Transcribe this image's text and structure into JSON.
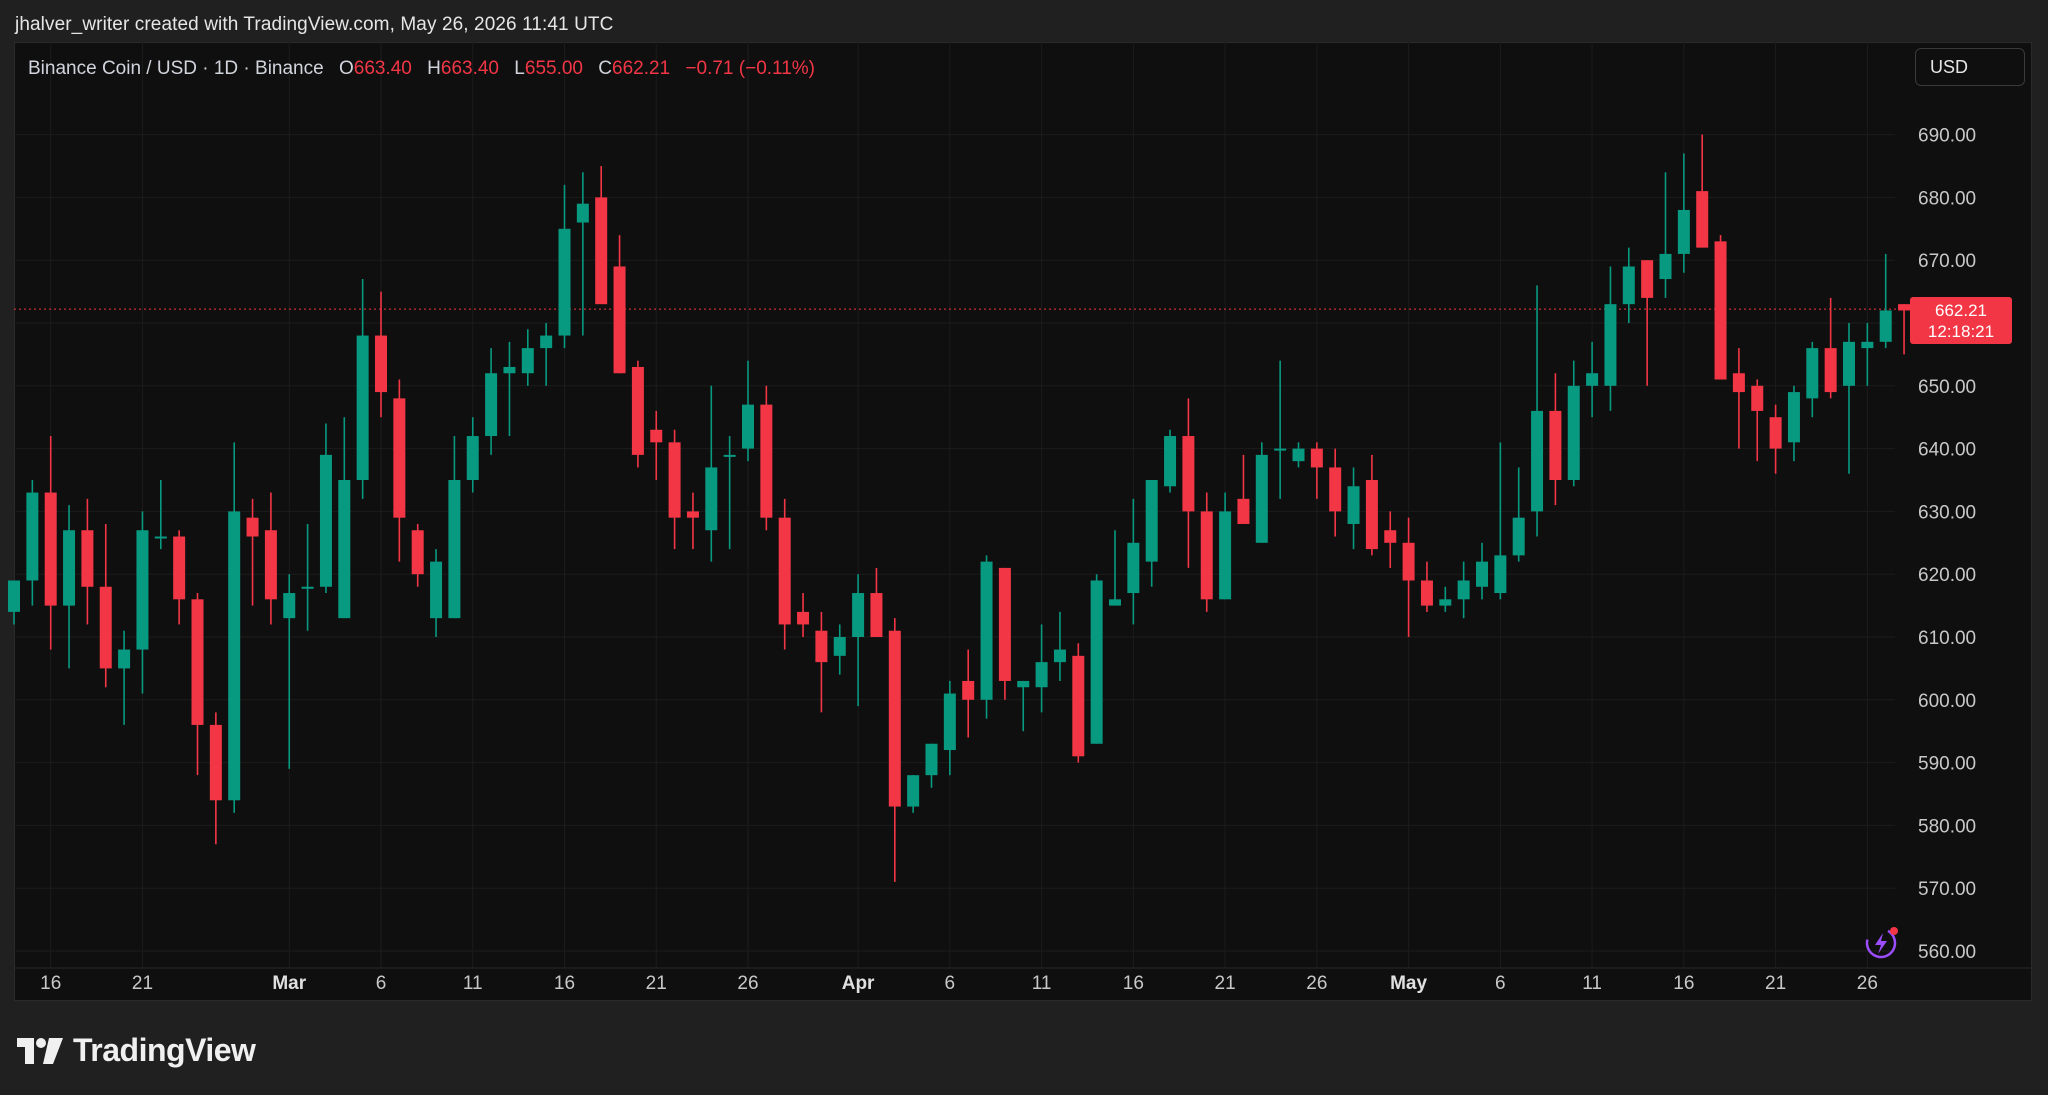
{
  "header": {
    "caption": "jhalver_writer created with TradingView.com, May 26, 2026 11:41 UTC"
  },
  "legend": {
    "symbol": "Binance Coin / USD · 1D · Binance",
    "o_label": "O",
    "o_value": "663.40",
    "h_label": "H",
    "h_value": "663.40",
    "l_label": "L",
    "l_value": "655.00",
    "c_label": "C",
    "c_value": "662.21",
    "change": "−0.71 (−0.11%)"
  },
  "currency_button": {
    "label": "USD"
  },
  "last_price": {
    "price": "662.21",
    "countdown": "12:18:21"
  },
  "brand": {
    "name": "TradingView"
  },
  "icons": {
    "logo": "tradingview-logo-icon",
    "alert": "lightning-alert-icon"
  },
  "colors": {
    "up": "#089981",
    "down": "#f23645",
    "background": "#0f0f0f",
    "grid": "#1c1c1c",
    "alert_icon": "#9c4dff"
  },
  "chart_data": {
    "type": "candlestick",
    "title": "Binance Coin / USD · 1D · Binance",
    "ylim": [
      558,
      695
    ],
    "y_ticks": [
      560,
      570,
      580,
      590,
      600,
      610,
      620,
      630,
      640,
      650,
      660,
      670,
      680,
      690
    ],
    "y_tick_labels": [
      "560.00",
      "570.00",
      "580.00",
      "590.00",
      "600.00",
      "610.00",
      "620.00",
      "630.00",
      "640.00",
      "650.00",
      "660.00",
      "670.00",
      "680.00",
      "690.00"
    ],
    "x_ticks": [
      {
        "label": "16",
        "index": 2,
        "bold": false
      },
      {
        "label": "21",
        "index": 7,
        "bold": false
      },
      {
        "label": "Mar",
        "index": 15,
        "bold": true
      },
      {
        "label": "6",
        "index": 20,
        "bold": false
      },
      {
        "label": "11",
        "index": 25,
        "bold": false
      },
      {
        "label": "16",
        "index": 30,
        "bold": false
      },
      {
        "label": "21",
        "index": 35,
        "bold": false
      },
      {
        "label": "26",
        "index": 40,
        "bold": false
      },
      {
        "label": "Apr",
        "index": 46,
        "bold": true
      },
      {
        "label": "6",
        "index": 51,
        "bold": false
      },
      {
        "label": "11",
        "index": 56,
        "bold": false
      },
      {
        "label": "16",
        "index": 61,
        "bold": false
      },
      {
        "label": "21",
        "index": 66,
        "bold": false
      },
      {
        "label": "26",
        "index": 71,
        "bold": false
      },
      {
        "label": "May",
        "index": 76,
        "bold": true
      },
      {
        "label": "6",
        "index": 81,
        "bold": false
      },
      {
        "label": "11",
        "index": 86,
        "bold": false
      },
      {
        "label": "16",
        "index": 91,
        "bold": false
      },
      {
        "label": "21",
        "index": 96,
        "bold": false
      },
      {
        "label": "26",
        "index": 101,
        "bold": false
      }
    ],
    "last_price": 662.21,
    "candles": [
      [
        614,
        619,
        612,
        619
      ],
      [
        619,
        635,
        615,
        633
      ],
      [
        633,
        642,
        608,
        615
      ],
      [
        615,
        631,
        605,
        627
      ],
      [
        627,
        632,
        612,
        618
      ],
      [
        618,
        628,
        602,
        605
      ],
      [
        605,
        611,
        596,
        608
      ],
      [
        608,
        630,
        601,
        627
      ],
      [
        626,
        635,
        624,
        626
      ],
      [
        626,
        627,
        612,
        616
      ],
      [
        616,
        617,
        588,
        596
      ],
      [
        596,
        598,
        577,
        584
      ],
      [
        584,
        641,
        582,
        630
      ],
      [
        629,
        632,
        615,
        626
      ],
      [
        627,
        633,
        612,
        616
      ],
      [
        613,
        620,
        589,
        617
      ],
      [
        618,
        628,
        611,
        618
      ],
      [
        618,
        644,
        617,
        639
      ],
      [
        613,
        645,
        613,
        635
      ],
      [
        635,
        667,
        632,
        658
      ],
      [
        658,
        665,
        645,
        649
      ],
      [
        648,
        651,
        622,
        629
      ],
      [
        627,
        628,
        618,
        620
      ],
      [
        613,
        624,
        610,
        622
      ],
      [
        613,
        642,
        613,
        635
      ],
      [
        635,
        645,
        633,
        642
      ],
      [
        642,
        656,
        639,
        652
      ],
      [
        652,
        657,
        642,
        653
      ],
      [
        652,
        659,
        650,
        656
      ],
      [
        656,
        660,
        650,
        658
      ],
      [
        658,
        682,
        656,
        675
      ],
      [
        676,
        684,
        658,
        679
      ],
      [
        680,
        685,
        665,
        663
      ],
      [
        669,
        674,
        652,
        652
      ],
      [
        653,
        654,
        637,
        639
      ],
      [
        643,
        646,
        635,
        641
      ],
      [
        641,
        643,
        624,
        629
      ],
      [
        630,
        633,
        624,
        629
      ],
      [
        627,
        650,
        622,
        637
      ],
      [
        639,
        642,
        624,
        639
      ],
      [
        640,
        654,
        638,
        647
      ],
      [
        647,
        650,
        627,
        629
      ],
      [
        629,
        632,
        608,
        612
      ],
      [
        614,
        617,
        610,
        612
      ],
      [
        611,
        614,
        598,
        606
      ],
      [
        607,
        612,
        604,
        610
      ],
      [
        610,
        620,
        599,
        617
      ],
      [
        617,
        621,
        610,
        610
      ],
      [
        611,
        613,
        571,
        583
      ],
      [
        583,
        588,
        582,
        588
      ],
      [
        588,
        593,
        586,
        593
      ],
      [
        592,
        603,
        588,
        601
      ],
      [
        603,
        608,
        594,
        600
      ],
      [
        600,
        623,
        597,
        622
      ],
      [
        621,
        621,
        600,
        603
      ],
      [
        602,
        603,
        595,
        603
      ],
      [
        602,
        612,
        598,
        606
      ],
      [
        606,
        614,
        603,
        608
      ],
      [
        607,
        609,
        590,
        591
      ],
      [
        593,
        620,
        593,
        619
      ],
      [
        615,
        627,
        615,
        616
      ],
      [
        617,
        632,
        612,
        625
      ],
      [
        622,
        632,
        618,
        635
      ],
      [
        634,
        643,
        633,
        642
      ],
      [
        642,
        648,
        621,
        630
      ],
      [
        630,
        633,
        614,
        616
      ],
      [
        616,
        633,
        616,
        630
      ],
      [
        632,
        639,
        628,
        628
      ],
      [
        625,
        641,
        625,
        639
      ],
      [
        640,
        654,
        632,
        640
      ],
      [
        638,
        641,
        637,
        640
      ],
      [
        640,
        641,
        632,
        637
      ],
      [
        637,
        640,
        626,
        630
      ],
      [
        628,
        637,
        624,
        634
      ],
      [
        635,
        639,
        623,
        624
      ],
      [
        627,
        630,
        621,
        625
      ],
      [
        625,
        629,
        610,
        619
      ],
      [
        619,
        622,
        614,
        615
      ],
      [
        615,
        618,
        614,
        616
      ],
      [
        616,
        622,
        613,
        619
      ],
      [
        618,
        625,
        616,
        622
      ],
      [
        617,
        641,
        616,
        623
      ],
      [
        623,
        637,
        622,
        629
      ],
      [
        630,
        666,
        626,
        646
      ],
      [
        646,
        652,
        631,
        635
      ],
      [
        635,
        654,
        634,
        650
      ],
      [
        650,
        657,
        645,
        652
      ],
      [
        650,
        669,
        646,
        663
      ],
      [
        663,
        672,
        660,
        669
      ],
      [
        670,
        670,
        650,
        664
      ],
      [
        667,
        684,
        664,
        671
      ],
      [
        671,
        687,
        668,
        678
      ],
      [
        681,
        690,
        672,
        672
      ],
      [
        673,
        674,
        655,
        651
      ],
      [
        652,
        656,
        640,
        649
      ],
      [
        650,
        651,
        638,
        646
      ],
      [
        645,
        647,
        636,
        640
      ],
      [
        641,
        650,
        638,
        649
      ],
      [
        648,
        657,
        645,
        656
      ],
      [
        656,
        664,
        648,
        649
      ],
      [
        650,
        660,
        636,
        657
      ],
      [
        656,
        660,
        650,
        657
      ],
      [
        657,
        671,
        656,
        662
      ],
      [
        663,
        663,
        655,
        662
      ]
    ]
  }
}
